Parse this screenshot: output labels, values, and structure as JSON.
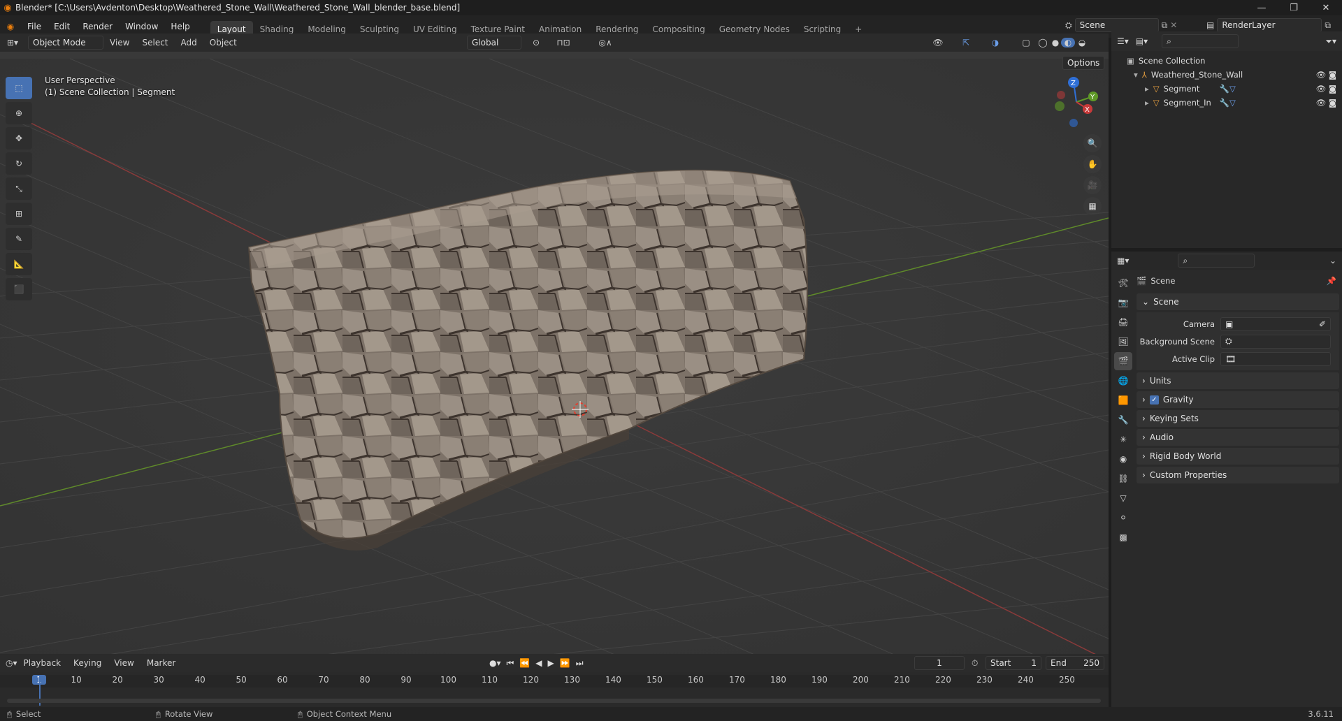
{
  "window": {
    "title": "Blender* [C:\\Users\\Avdenton\\Desktop\\Weathered_Stone_Wall\\Weathered_Stone_Wall_blender_base.blend]",
    "minimize": "—",
    "maximize": "❐",
    "close": "✕"
  },
  "menu": [
    "File",
    "Edit",
    "Render",
    "Window",
    "Help"
  ],
  "workspaces": [
    "Layout",
    "Shading",
    "Modeling",
    "Sculpting",
    "UV Editing",
    "Texture Paint",
    "Animation",
    "Rendering",
    "Compositing",
    "Geometry Nodes",
    "Scripting"
  ],
  "workspace_add": "+",
  "scene_field": "Scene",
  "renderlayer_field": "RenderLayer",
  "viewport": {
    "mode": "Object Mode",
    "menus": [
      "View",
      "Select",
      "Add",
      "Object"
    ],
    "transform_orientation": "Global",
    "options": "Options",
    "info_line1": "User Perspective",
    "info_line2": "(1) Scene Collection | Segment",
    "gizmo_axes": [
      "Z",
      "Y",
      "X"
    ]
  },
  "outliner": {
    "root": "Scene Collection",
    "collection": "Weathered_Stone_Wall",
    "objects": [
      "Segment",
      "Segment_In"
    ]
  },
  "properties": {
    "header": "Scene",
    "panel": "Scene",
    "fields": [
      {
        "label": "Camera",
        "value": ""
      },
      {
        "label": "Background Scene",
        "value": ""
      },
      {
        "label": "Active Clip",
        "value": ""
      }
    ],
    "sections": [
      "Units",
      "Gravity",
      "Keying Sets",
      "Audio",
      "Rigid Body World",
      "Custom Properties"
    ],
    "gravity_checked": true
  },
  "timeline": {
    "menus": [
      "Playback",
      "Keying",
      "View",
      "Marker"
    ],
    "current_frame": "1",
    "start_label": "Start",
    "start": "1",
    "end_label": "End",
    "end": "250",
    "ticks": [
      "1",
      "10",
      "20",
      "30",
      "40",
      "50",
      "60",
      "70",
      "80",
      "90",
      "100",
      "110",
      "120",
      "130",
      "140",
      "150",
      "160",
      "170",
      "180",
      "190",
      "200",
      "210",
      "220",
      "230",
      "240",
      "250"
    ]
  },
  "status": {
    "select": "Select",
    "rotate": "Rotate View",
    "context": "Object Context Menu",
    "version": "3.6.11"
  },
  "colors": {
    "accent": "#4772b3",
    "x_axis": "#c83a3a",
    "y_axis": "#5f9a27",
    "z_axis": "#2f6fd6",
    "header_bg": "#2b2b2b",
    "viewport_bg": "#393939"
  }
}
